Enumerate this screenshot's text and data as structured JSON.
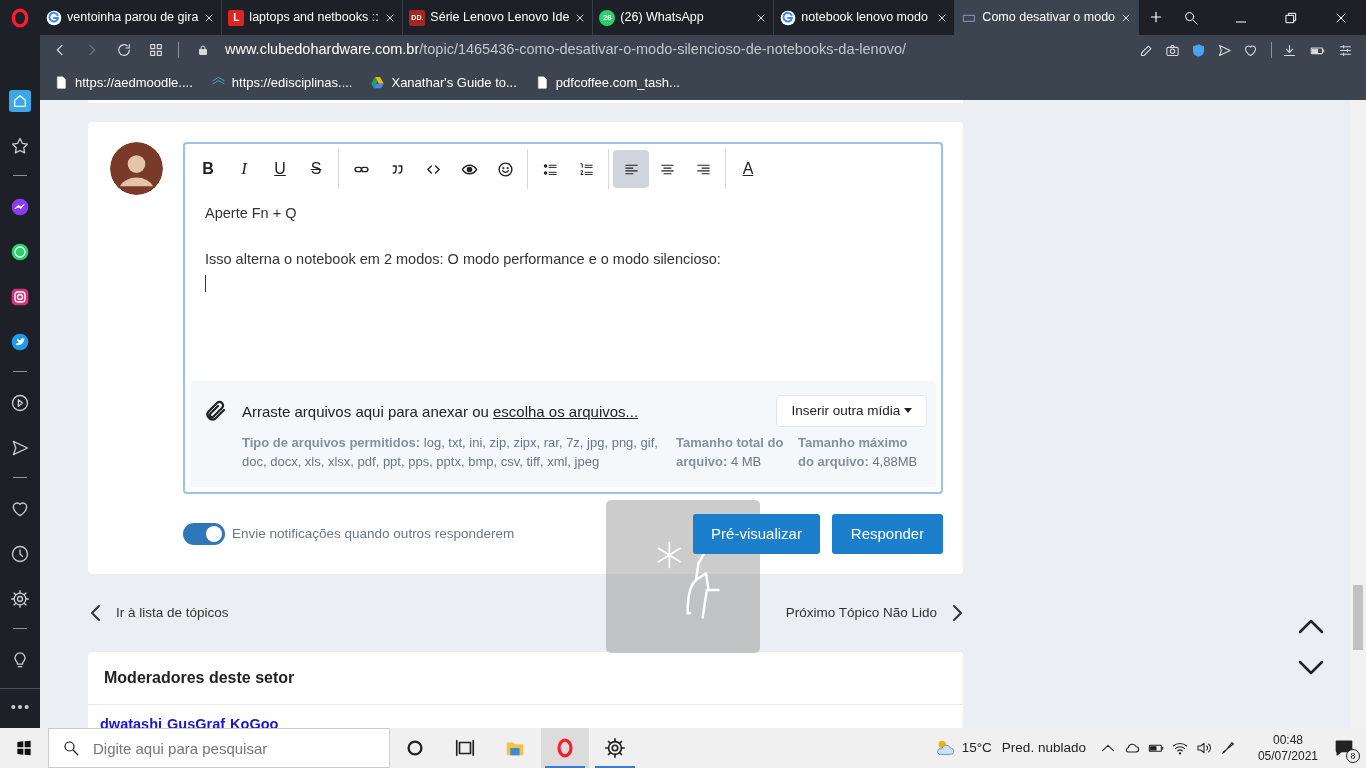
{
  "browser": {
    "tabs": [
      {
        "title": "ventoinha parou de gira",
        "kind": "google",
        "selected": false
      },
      {
        "title": "laptops and netbooks ::",
        "kind": "letter",
        "favicon_text": "L",
        "color": "#e02424",
        "selected": false
      },
      {
        "title": "Série Lenovo Lenovo Ide",
        "kind": "letter",
        "favicon_text": "DD.",
        "color": "#a3281f",
        "selected": false
      },
      {
        "title": "(26) WhatsApp",
        "kind": "whatsapp",
        "favicon_text": "26",
        "selected": false
      },
      {
        "title": "notebook lenovo modo",
        "kind": "google",
        "selected": false
      },
      {
        "title": "Como desativar o modo",
        "kind": "site",
        "selected": true
      }
    ],
    "url_host": "www.clubedohardware.com.br",
    "url_path": "/topic/1465436-como-desativar-o-modo-silencioso-de-notebooks-da-lenovo/",
    "bookmarks": [
      {
        "title": "https://aedmoodle....",
        "kind": "page"
      },
      {
        "title": "https://edisciplinas....",
        "kind": "layers"
      },
      {
        "title": "Xanathar's Guide to...",
        "kind": "drive"
      },
      {
        "title": "pdfcoffee.com_tash...",
        "kind": "page"
      }
    ],
    "sidebar": [
      [
        {
          "kind": "home",
          "selected": true
        },
        {
          "kind": "star",
          "selected": false
        }
      ],
      [
        {
          "kind": "messenger",
          "selected": false
        },
        {
          "kind": "whatsapp",
          "selected": false
        },
        {
          "kind": "instagram",
          "selected": false
        },
        {
          "kind": "twitter",
          "selected": false
        }
      ],
      [
        {
          "kind": "player",
          "selected": false
        },
        {
          "kind": "send",
          "selected": false
        }
      ],
      [
        {
          "kind": "heart",
          "selected": false
        },
        {
          "kind": "history",
          "selected": false
        },
        {
          "kind": "settings",
          "selected": false
        }
      ],
      [
        {
          "kind": "bulb",
          "selected": false
        }
      ]
    ]
  },
  "editor": {
    "toolbar": [
      [
        {
          "kind": "bold",
          "label": "B",
          "active": false
        },
        {
          "kind": "italic",
          "label": "I",
          "active": false
        },
        {
          "kind": "underline",
          "label": "U",
          "active": false
        },
        {
          "kind": "strike",
          "label": "S",
          "active": false
        }
      ],
      [
        {
          "kind": "link",
          "active": false
        },
        {
          "kind": "quote",
          "active": false
        },
        {
          "kind": "code",
          "active": false
        },
        {
          "kind": "preview",
          "active": false
        },
        {
          "kind": "emoji",
          "active": false
        }
      ],
      [
        {
          "kind": "bullets",
          "active": false
        },
        {
          "kind": "numbers",
          "active": false
        }
      ],
      [
        {
          "kind": "align-left",
          "active": true
        },
        {
          "kind": "align-center",
          "active": false
        },
        {
          "kind": "align-right",
          "active": false
        }
      ],
      [
        {
          "kind": "font-color",
          "label": "A",
          "active": false
        }
      ]
    ],
    "paragraphs": [
      "Aperte Fn + Q",
      "Isso alterna o notebook em 2 modos: O modo performance e o modo silencioso:"
    ],
    "attachments": {
      "prompt": "Arraste arquivos aqui para anexar ou",
      "choose_link": "escolha os arquivos...",
      "media_button": "Inserir outra mídia",
      "allowed": "**Tipo de arquivos permitidos:** log, txt, ini, zip, zipx, rar, 7z, jpg, png, gif, doc, docx, xls, xlsx, pdf, ppt, pps, pptx, bmp, csv, tiff, xml, jpeg",
      "total_size": "**Tamanho total do arquivo:** 4 MB",
      "max_size": "**Tamanho máximo do arquivo:** 4,88MB"
    }
  },
  "notify": {
    "label": "Envie notificações quando outros responderem",
    "on": true
  },
  "buttons": [
    "Pré-visualizar",
    "Responder"
  ],
  "nav": {
    "previous": "Ir à lista de tópicos",
    "next": "Próximo Tópico Não Lido"
  },
  "moderators": {
    "title": "Moderadores deste setor",
    "names": [
      "dwatashi",
      "GusGraf",
      "KoGoo"
    ]
  },
  "taskbar": {
    "search_placeholder": "Digite aqui para pesquisar",
    "temperature": "15°C",
    "weather": "Pred. nublado",
    "time": "00:48",
    "date": "05/07/2021",
    "notifications": "8"
  }
}
